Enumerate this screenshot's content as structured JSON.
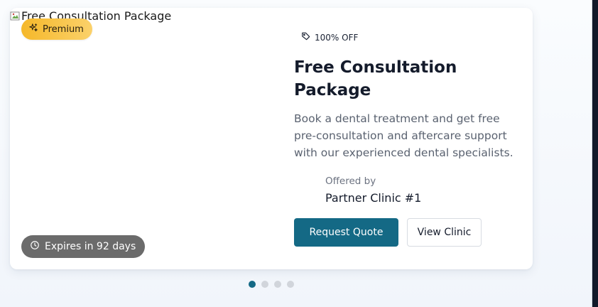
{
  "offer": {
    "image_alt": "Free Consultation Package",
    "premium_label": "Premium",
    "expiry_label": "Expires in 92 days",
    "discount_label": "100% OFF",
    "title": "Free Consultation Package",
    "description": "Book a dental treatment and get free pre-consultation and aftercare support with our experienced dental specialists.",
    "offered_by_label": "Offered by",
    "clinic_name": "Partner Clinic #1",
    "primary_button": "Request Quote",
    "secondary_button": "View Clinic"
  },
  "carousel": {
    "dots": [
      "slide-1",
      "slide-2",
      "slide-3",
      "slide-4"
    ],
    "active_index": 0
  },
  "colors": {
    "primary": "#146985",
    "premium_badge": "#f5b82a",
    "expiry_badge": "#6b6b6b"
  },
  "icons": {
    "premium": "sparkles-icon",
    "expiry": "clock-icon",
    "discount": "tag-icon",
    "broken_image": "broken-image-icon"
  }
}
